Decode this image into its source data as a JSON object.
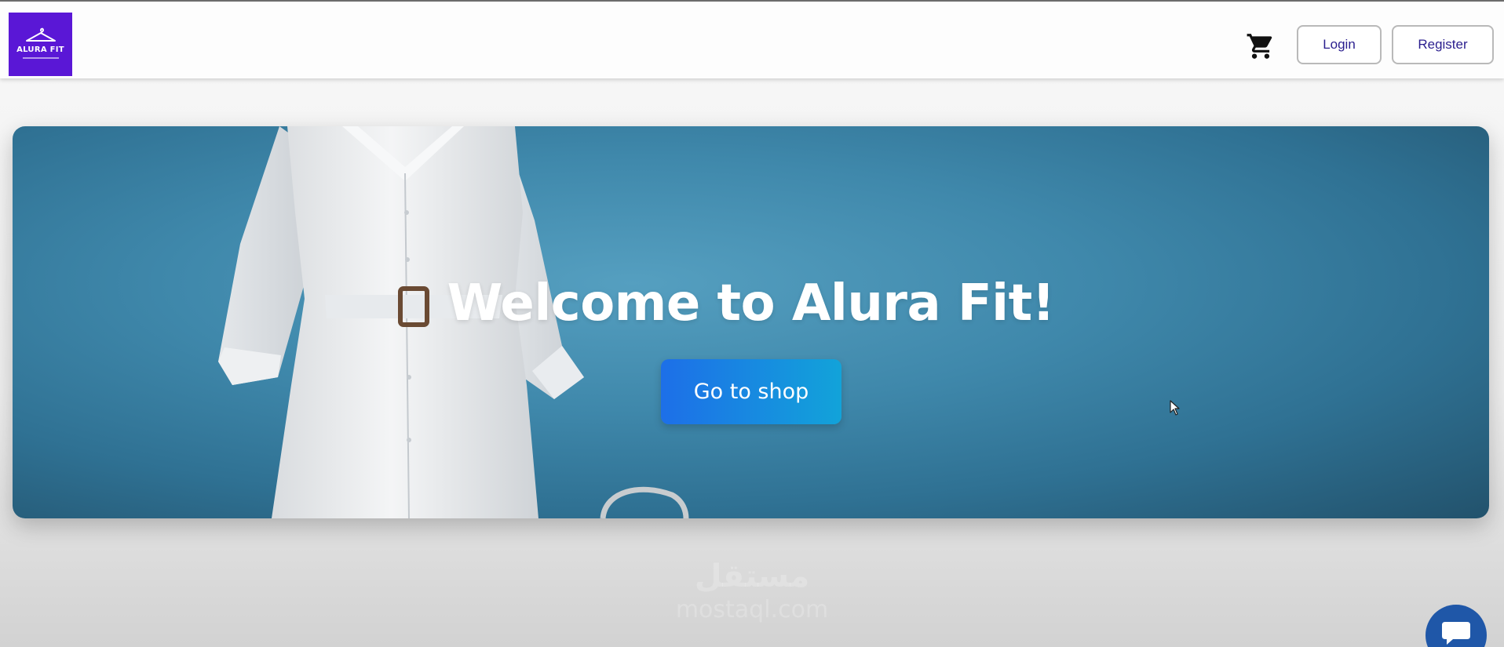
{
  "colors": {
    "brand_purple": "#5a17d6",
    "login_text": "#2a1e8e",
    "hero_bg": "#3f88ab",
    "shop_button_gradient_start": "#1d6fe8",
    "shop_button_gradient_end": "#12a3d9",
    "chat_bubble": "#1f57a8"
  },
  "header": {
    "logo": {
      "text": "ALURA FIT",
      "icon": "clothes-hanger-icon"
    },
    "cart_icon": "shopping-cart-icon",
    "login_label": "Login",
    "register_label": "Register"
  },
  "hero": {
    "title": "Welcome to Alura Fit!",
    "cta_label": "Go to shop",
    "image": "white-shirt-dress-on-mannequin"
  },
  "watermark": {
    "line1": "مستقل",
    "line2": "mostaql.com"
  },
  "chat": {
    "icon": "chat-bubble-icon"
  }
}
